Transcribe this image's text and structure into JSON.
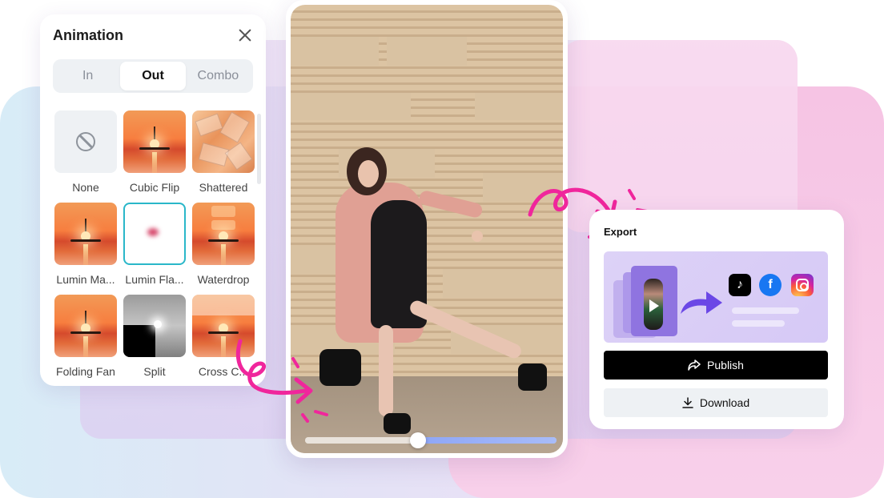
{
  "animation_panel": {
    "title": "Animation",
    "tabs": [
      {
        "label": "In",
        "active": false
      },
      {
        "label": "Out",
        "active": true
      },
      {
        "label": "Combo",
        "active": false
      }
    ],
    "items": [
      {
        "label": "None",
        "thumb": "none"
      },
      {
        "label": "Cubic Flip",
        "thumb": "sunset"
      },
      {
        "label": "Shattered",
        "thumb": "shatter"
      },
      {
        "label": "Lumin Ma...",
        "thumb": "sunset"
      },
      {
        "label": "Lumin Fla...",
        "thumb": "flash",
        "selected": true
      },
      {
        "label": "Waterdrop",
        "thumb": "water"
      },
      {
        "label": "Folding Fan",
        "thumb": "sunset"
      },
      {
        "label": "Split",
        "thumb": "split"
      },
      {
        "label": "Cross C...",
        "thumb": "cross"
      }
    ]
  },
  "video": {
    "progress": 0.45
  },
  "export_panel": {
    "title": "Export",
    "social_icons": [
      "tiktok-icon",
      "facebook-icon",
      "instagram-icon"
    ],
    "publish_label": "Publish",
    "download_label": "Download"
  },
  "colors": {
    "accent_pink": "#f0269c",
    "selected_border": "#2ab7c9",
    "progress_blue": "#8ea6f7",
    "publish_bg": "#000000"
  }
}
